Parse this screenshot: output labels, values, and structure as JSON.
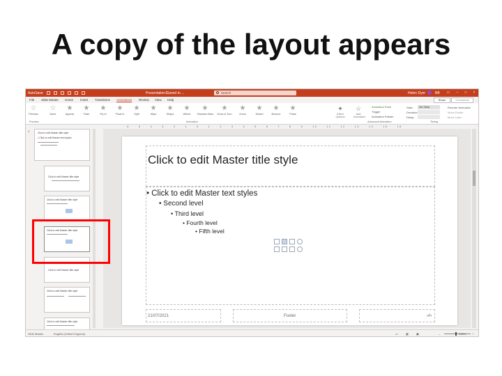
{
  "slide_heading": "A copy of the layout appears",
  "app": {
    "titlebar": {
      "autosave": "AutoSave",
      "doc_name": "Presentation1",
      "saved_state": "Saved to ...",
      "search_placeholder": "Search",
      "user_name": "Helen Dyer",
      "window_label": "BB",
      "accent_color": "#c43e1c"
    },
    "tabs": [
      "File",
      "Slide Master",
      "Home",
      "Insert",
      "Transitions",
      "Animations",
      "Review",
      "View",
      "Help"
    ],
    "active_tab": "Animations",
    "share_label": "Share",
    "comments_label": "Comments",
    "ribbon": {
      "preview_label": "Preview",
      "animations": [
        "None",
        "Appear",
        "Fade",
        "Fly In",
        "Float In",
        "Split",
        "Wipe",
        "Shape",
        "Wheel",
        "Random Bars",
        "Grow & Turn",
        "Zoom",
        "Swivel",
        "Bounce",
        "Pulse"
      ],
      "effect_options": "Effect Options",
      "add_animation": "Add Animation",
      "animation_pane": "Animation Pane",
      "trigger": "Trigger",
      "animation_painter": "Animation Painter",
      "start_label": "Start:",
      "start_value": "On Click",
      "duration_label": "Duration:",
      "delay_label": "Delay:",
      "reorder_label": "Reorder Animation",
      "move_earlier": "Move Earlier",
      "move_later": "Move Later",
      "group_preview": "Preview",
      "group_animation": "Animation",
      "group_advanced": "Advanced Animation",
      "group_timing": "Timing"
    },
    "thumbnails": {
      "number_1": "1",
      "t1_title": "Click to edit Master title style",
      "t1_text": "• Click to edit Master text styles",
      "t2_title": "Click to edit Master title style",
      "t3_title": "Click to edit Master title style",
      "t4_title": "Click to edit Master title style",
      "t5_title": "Click to edit Master title style",
      "t6_title": "Click to edit Master title style",
      "t7_title": "Click to edit Master title style"
    },
    "slide": {
      "title": "Click to edit Master title style",
      "bullets": [
        "• Click to edit Master text styles",
        "• Second level",
        "• Third level",
        "• Fourth level",
        "• Fifth level"
      ],
      "date": "21/07/2021",
      "footer": "Footer",
      "page_num": "‹#›"
    },
    "statusbar": {
      "view": "Slide Master",
      "language": "English (United Kingdom)",
      "zoom": "130%"
    }
  }
}
